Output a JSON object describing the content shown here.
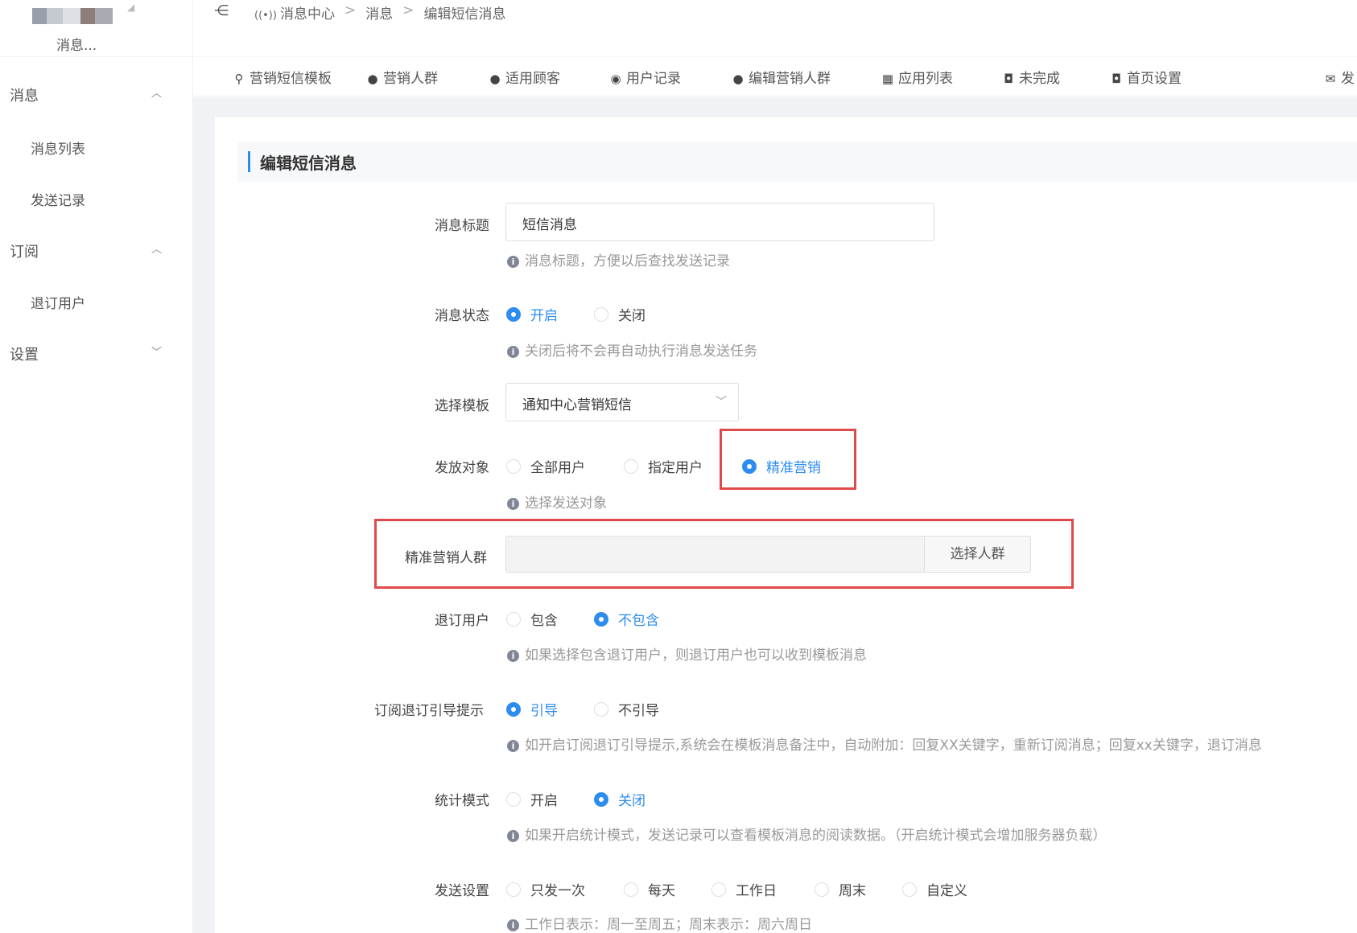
{
  "sidebar": {
    "logo_label": "消息...",
    "groups": [
      {
        "label": "消息",
        "chevron": "chevron-up-icon",
        "items": [
          "消息列表",
          "发送记录"
        ]
      },
      {
        "label": "订阅",
        "chevron": "chevron-up-icon",
        "items": [
          "退订用户"
        ]
      },
      {
        "label": "设置",
        "chevron": "chevron-down-icon",
        "items": []
      }
    ]
  },
  "header": {
    "breadcrumb": [
      "消息中心",
      "消息",
      "编辑短信消息"
    ]
  },
  "topnav": [
    {
      "label": "营销短信模板",
      "icon": "user-search-icon"
    },
    {
      "label": "营销人群",
      "icon": "info-circle-icon"
    },
    {
      "label": "适用顾客",
      "icon": "info-circle-icon"
    },
    {
      "label": "用户记录",
      "icon": "broadcast-icon"
    },
    {
      "label": "编辑营销人群",
      "icon": "info-circle-icon"
    },
    {
      "label": "应用列表",
      "icon": "grid-icon"
    },
    {
      "label": "未完成",
      "icon": "truck-icon"
    },
    {
      "label": "首页设置",
      "icon": "truck-icon"
    },
    {
      "label": "发",
      "icon": "mail-icon"
    }
  ],
  "form": {
    "title": "编辑短信消息",
    "msg_title": {
      "label": "消息标题",
      "value": "短信消息",
      "hint": "消息标题，方便以后查找发送记录"
    },
    "msg_status": {
      "label": "消息状态",
      "options": [
        "开启",
        "关闭"
      ],
      "selected": 0,
      "hint": "关闭后将不会再自动执行消息发送任务"
    },
    "template": {
      "label": "选择模板",
      "value": "通知中心营销短信"
    },
    "target": {
      "label": "发放对象",
      "options": [
        "全部用户",
        "指定用户",
        "精准营销"
      ],
      "selected": 2,
      "hint": "选择发送对象"
    },
    "audience": {
      "label": "精准营销人群",
      "button": "选择人群"
    },
    "unsubscribed": {
      "label": "退订用户",
      "options": [
        "包含",
        "不包含"
      ],
      "selected": 1,
      "hint": "如果选择包含退订用户，则退订用户也可以收到模板消息"
    },
    "guide": {
      "label": "订阅退订引导提示",
      "options": [
        "引导",
        "不引导"
      ],
      "selected": 0,
      "hint": "如开启订阅退订引导提示,系统会在模板消息备注中，自动附加：回复XX关键字，重新订阅消息；回复xx关键字，退订消息"
    },
    "stats": {
      "label": "统计模式",
      "options": [
        "开启",
        "关闭"
      ],
      "selected": 1,
      "hint": "如果开启统计模式，发送记录可以查看模板消息的阅读数据。（开启统计模式会增加服务器负载）"
    },
    "send": {
      "label": "发送设置",
      "options": [
        "只发一次",
        "每天",
        "工作日",
        "周末",
        "自定义"
      ],
      "selected": -1,
      "hint": "工作日表示：周一至周五；周末表示：周六周日"
    }
  },
  "colors": {
    "accent": "#2d8cf0",
    "highlight_box": "#e04a4a"
  }
}
